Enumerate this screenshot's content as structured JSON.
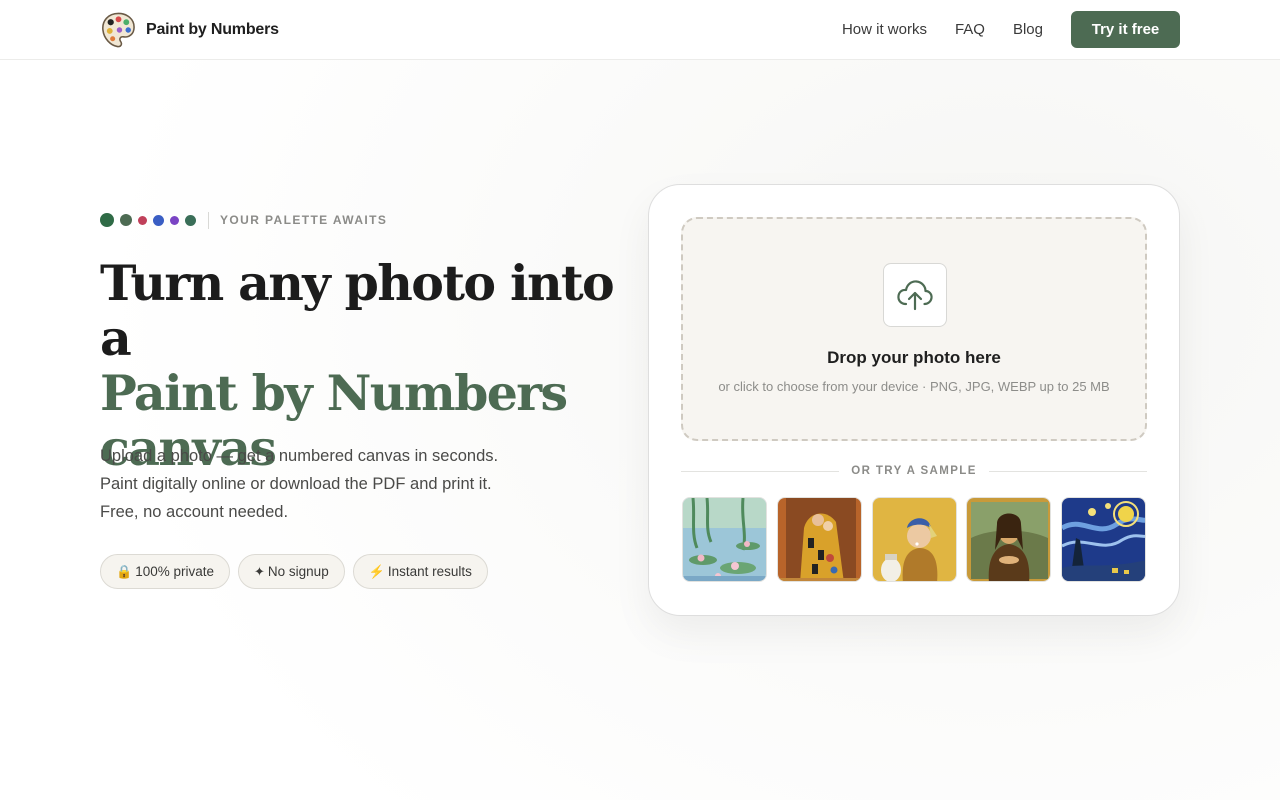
{
  "brand": {
    "name": "Paint by Numbers",
    "logo": "palette-icon"
  },
  "nav": {
    "links": [
      "How it works",
      "FAQ",
      "Blog"
    ],
    "cta": "Try it free",
    "accent": "#4d6b53"
  },
  "hero": {
    "eyebrow": "YOUR PALETTE AWAITS",
    "eyebrow_dots": [
      "#2f6b46",
      "#4d6b53",
      "#c0405a",
      "#3a5ec4",
      "#7a44c4",
      "#3a6e58"
    ],
    "headline_line1": "Turn any photo into a",
    "headline_line2": "Paint by Numbers",
    "headline_line3": "canvas",
    "lede": [
      "Upload a photo — get a numbered canvas in seconds.",
      "Paint digitally online or download the PDF and print it.",
      "Free, no account needed."
    ],
    "chips": [
      {
        "icon": "lock-icon",
        "glyph": "🔒",
        "label": "100% private"
      },
      {
        "icon": "sparkle-icon",
        "glyph": "✦",
        "label": "No signup"
      },
      {
        "icon": "lightning-icon",
        "glyph": "⚡",
        "label": "Instant results"
      }
    ]
  },
  "upload": {
    "icon": "cloud-upload-icon",
    "title": "Drop your photo here",
    "subtitle": "or click to choose from your device · PNG, JPG, WEBP up to 25 MB",
    "samples_label": "OR TRY A SAMPLE",
    "samples": [
      "water-lilies-sample",
      "the-kiss-sample",
      "girl-with-pearl-earring-sample",
      "mona-lisa-sample",
      "starry-night-sample"
    ]
  }
}
